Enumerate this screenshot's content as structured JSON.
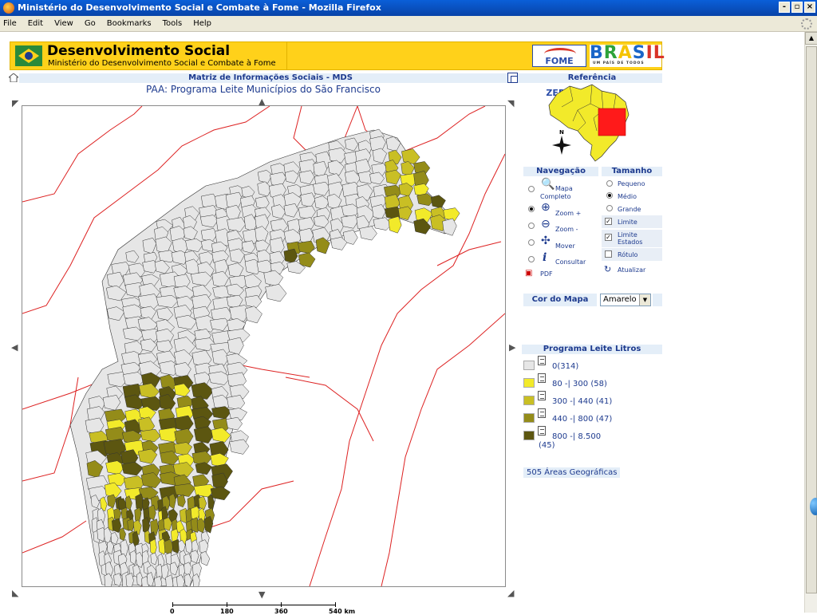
{
  "window": {
    "title": "Ministério do Desenvolvimento Social e Combate à Fome - Mozilla Firefox",
    "controls": [
      "-",
      "▫",
      "×"
    ]
  },
  "menu": [
    "File",
    "Edit",
    "View",
    "Go",
    "Bookmarks",
    "Tools",
    "Help"
  ],
  "banner": {
    "title": "Desenvolvimento Social",
    "subtitle": "Ministério do Desenvolvimento Social e Combate à Fome",
    "logo_fome": "FOME ZERO",
    "logo_brasil": "BRASIL",
    "logo_brasil_tag": "UM PAÍS DE TODOS"
  },
  "header": {
    "matriz": "Matriz de Informações Sociais - MDS",
    "map_title": "PAA: Programa Leite Municípios do São Francisco"
  },
  "map": {
    "scale_labels": [
      "0",
      "180",
      "360",
      "540 km"
    ],
    "fill_colors": {
      "c0": "#e6e6e6",
      "c1": "#f2ea2a",
      "c2": "#c9bf24",
      "c3": "#948c19",
      "c4": "#5c5610"
    },
    "border_color": "#333333",
    "state_border_color": "#dd2222"
  },
  "reference": {
    "title": "Referência",
    "north": "N"
  },
  "navigation": {
    "title": "Navegação",
    "items": [
      {
        "label_1": "Mapa",
        "label_2": "Completo",
        "icon": "globe-zoom-icon",
        "selected": false
      },
      {
        "label_1": "Zoom +",
        "label_2": "",
        "icon": "zoom-in-icon",
        "selected": true
      },
      {
        "label_1": "Zoom -",
        "label_2": "",
        "icon": "zoom-out-icon",
        "selected": false
      },
      {
        "label_1": "Mover",
        "label_2": "",
        "icon": "move-icon",
        "selected": false
      },
      {
        "label_1": "Consultar",
        "label_2": "",
        "icon": "info-icon",
        "selected": false
      }
    ],
    "pdf": "PDF"
  },
  "size": {
    "title": "Tamanho",
    "options": [
      {
        "label": "Pequeno",
        "selected": false
      },
      {
        "label": "Médio",
        "selected": true
      },
      {
        "label": "Grande",
        "selected": false
      }
    ],
    "checks": [
      {
        "label_1": "Limite",
        "label_2": "",
        "checked": true
      },
      {
        "label_1": "Limite",
        "label_2": "Estados",
        "checked": true
      },
      {
        "label_1": "Rótulo",
        "label_2": "",
        "checked": false
      }
    ],
    "update": "Atualizar"
  },
  "color": {
    "label": "Cor do Mapa",
    "value": "Amarelo"
  },
  "legend": {
    "title": "Programa Leite Litros",
    "items": [
      {
        "text": "0(314)",
        "color": "#e6e6e6"
      },
      {
        "text": "80 -| 300 (58)",
        "color": "#f2ea2a"
      },
      {
        "text": "300 -| 440 (41)",
        "color": "#c9bf24"
      },
      {
        "text": "440 -| 800 (47)",
        "color": "#948c19"
      },
      {
        "text": "800 -| 8.500",
        "text_2": "(45)",
        "color": "#5c5610"
      }
    ]
  },
  "areas": "505 Áreas Geográficas"
}
